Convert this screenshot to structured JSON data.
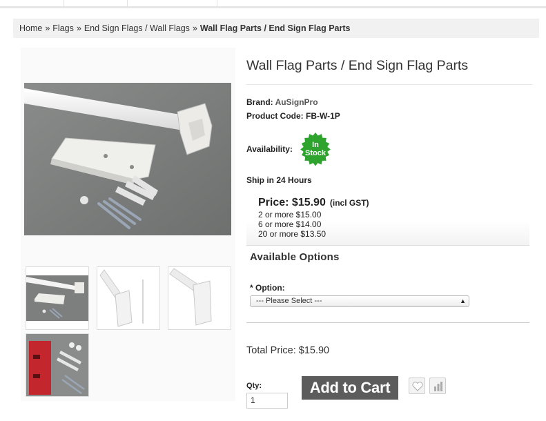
{
  "breadcrumb": {
    "items": [
      "Home",
      "Flags",
      "End Sign Flags / Wall Flags"
    ],
    "current": "Wall Flag Parts / End Sign Flag Parts",
    "separator": "»"
  },
  "product": {
    "title": "Wall Flag Parts / End Sign Flag Parts",
    "brand_label": "Brand:",
    "brand": "AuSignPro",
    "code_label": "Product Code:",
    "code": "FB-W-1P",
    "availability_label": "Availability:",
    "stock_line1": "In",
    "stock_line2": "Stock",
    "ship_prefix": "Ship in",
    "ship_time": "24 Hours"
  },
  "price": {
    "label": "Price: $15.90",
    "tax_note": "(incl GST)",
    "discounts": [
      "2 or more $15.00",
      "6 or more $14.00",
      "20 or more $13.50"
    ]
  },
  "options": {
    "title": "Available Options",
    "option_label": "* Option:",
    "select_value": "--- Please Select ---"
  },
  "total_price": "Total Price: $15.90",
  "cart": {
    "qty_label": "Qty:",
    "qty_value": "1",
    "add_to_cart": "Add to Cart"
  },
  "icons": {
    "wishlist": "heart-icon",
    "compare": "bar-chart-icon",
    "select_arrow": "up-down-arrow-icon"
  },
  "colors": {
    "stock_badge": "#2ea32e",
    "add_to_cart_bg": "#5c5c5c",
    "breadcrumb_bg": "#f1f1f1"
  }
}
